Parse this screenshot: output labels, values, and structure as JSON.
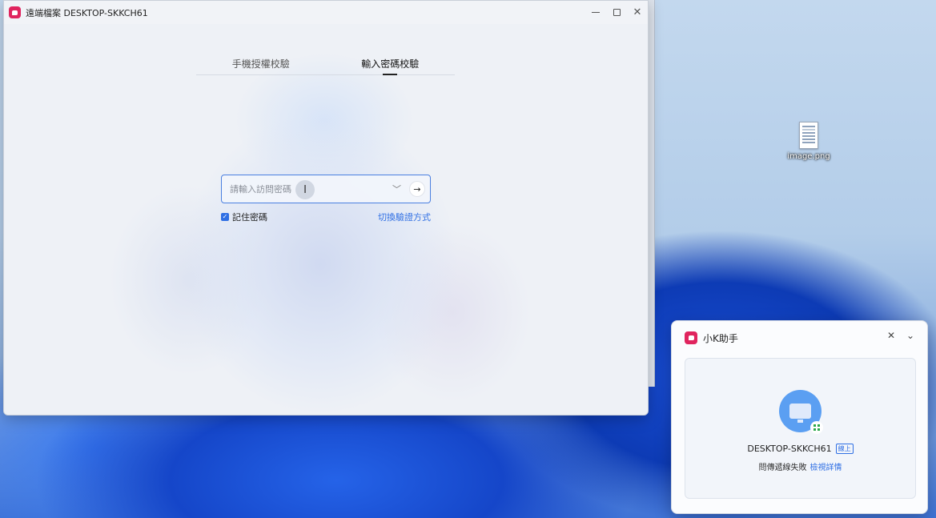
{
  "window": {
    "title": "遠端檔案 DESKTOP-SKKCH61"
  },
  "tabs": [
    {
      "label": "手機授權校驗",
      "active": false
    },
    {
      "label": "輸入密碼校驗",
      "active": true
    }
  ],
  "password": {
    "placeholder": "請輸入訪問密碼",
    "value": ""
  },
  "remember_label": "記住密碼",
  "remember_checked": true,
  "switch_label": "切換驗證方式",
  "desktop_icon": {
    "label": "image.png"
  },
  "assistant": {
    "title": "小K助手",
    "device_name": "DESKTOP-SKKCH61",
    "online_badge": "線上",
    "status_text": "問傳遞線失敗",
    "details_link": "檢視詳情"
  },
  "colors": {
    "brand": "#e0245e",
    "accent": "#2f6fe4"
  }
}
